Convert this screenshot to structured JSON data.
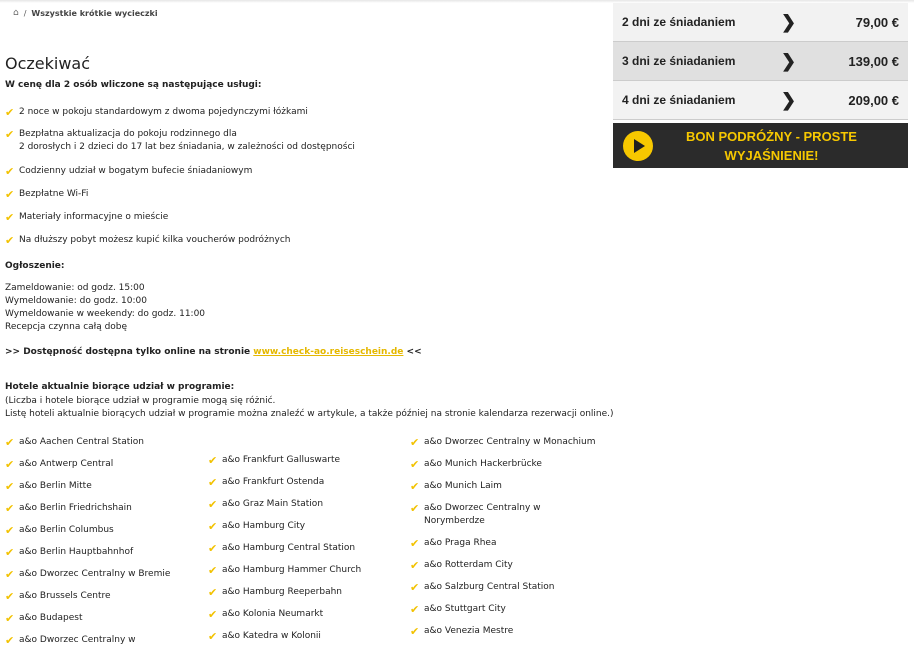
{
  "breadcrumb": {
    "home_icon": "home-icon",
    "separator": "/",
    "current": "Wszystkie krótkie wycieczki"
  },
  "title": "Oczekiwać",
  "included_heading": "W cenę dla 2 osób wliczone są następujące usługi:",
  "features": [
    {
      "line1": "2 noce w pokoju standardowym z dwoma pojedynczymi łóżkami",
      "line2": ""
    },
    {
      "line1": "Bezpłatna aktualizacja do pokoju rodzinnego dla",
      "line2": "2 dorosłych i 2 dzieci do 17 lat bez śniadania, w zależności od dostępności"
    },
    {
      "line1": "Codzienny udział w bogatym bufecie śniadaniowym",
      "line2": ""
    },
    {
      "line1": "Bezpłatne Wi-Fi",
      "line2": ""
    },
    {
      "line1": "Materiały informacyjne o mieście",
      "line2": ""
    },
    {
      "line1": "Na dłuższy pobyt możesz kupić kilka voucherów podróżnych",
      "line2": ""
    }
  ],
  "notice": {
    "heading": "Ogłoszenie:",
    "lines": [
      "Zameldowanie: od godz. 15:00",
      "Wymeldowanie: do godz. 10:00",
      "Wymeldowanie w weekendy: do godz. 11:00",
      "Recepcja czynna całą dobę"
    ]
  },
  "availability": {
    "prefix": ">> Dostępność dostępna tylko online na stronie ",
    "link": "www.check-ao.reiseschein.de",
    "suffix": " <<"
  },
  "hotels": {
    "heading": "Hotele aktualnie biorące udział w programie:",
    "note1": "(Liczba i hotele biorące udział w programie mogą się różnić.",
    "note2": "Listę hoteli aktualnie biorących udział w programie można znaleźć w artykule, a także później na stronie kalendarza rezerwacji online.)",
    "col1": [
      {
        "line1": "a&o Aachen Central Station",
        "line2": ""
      },
      {
        "line1": "a&o Antwerp Central",
        "line2": ""
      },
      {
        "line1": "a&o Berlin Mitte",
        "line2": ""
      },
      {
        "line1": "a&o Berlin Friedrichshain",
        "line2": ""
      },
      {
        "line1": "a&o Berlin Columbus",
        "line2": ""
      },
      {
        "line1": "a&o Berlin Hauptbahnhof",
        "line2": ""
      },
      {
        "line1": "a&o Dworzec Centralny w Bremie",
        "line2": ""
      },
      {
        "line1": "a&o Brussels Centre",
        "line2": ""
      },
      {
        "line1": "a&o Budapest",
        "line2": ""
      },
      {
        "line1": "a&o Dworzec Centralny w",
        "line2": ""
      }
    ],
    "col2": [
      {
        "line1": "a&o Frankfurt Galluswarte",
        "line2": ""
      },
      {
        "line1": "a&o Frankfurt Ostenda",
        "line2": ""
      },
      {
        "line1": "a&o Graz Main Station",
        "line2": ""
      },
      {
        "line1": "a&o Hamburg City",
        "line2": ""
      },
      {
        "line1": "a&o Hamburg Central Station",
        "line2": ""
      },
      {
        "line1": "a&o Hamburg Hammer Church",
        "line2": ""
      },
      {
        "line1": "a&o Hamburg Reeperbahn",
        "line2": ""
      },
      {
        "line1": "a&o Kolonia Neumarkt",
        "line2": ""
      },
      {
        "line1": "a&o Katedra w Kolonii",
        "line2": ""
      }
    ],
    "col3": [
      {
        "line1": "a&o Dworzec Centralny w Monachium",
        "line2": ""
      },
      {
        "line1": "a&o Munich Hackerbrücke",
        "line2": ""
      },
      {
        "line1": "a&o Munich Laim",
        "line2": ""
      },
      {
        "line1": "a&o Dworzec Centralny w",
        "line2": "Norymberdze"
      },
      {
        "line1": "a&o Praga Rhea",
        "line2": ""
      },
      {
        "line1": "a&o Rotterdam City",
        "line2": ""
      },
      {
        "line1": "a&o Salzburg Central Station",
        "line2": ""
      },
      {
        "line1": "a&o Stuttgart City",
        "line2": ""
      },
      {
        "line1": "a&o Venezia Mestre",
        "line2": ""
      }
    ]
  },
  "offers": [
    {
      "label": "2 dni ze śniadaniem",
      "price": "79,00 €"
    },
    {
      "label": "3 dni ze śniadaniem",
      "price": "139,00 €"
    },
    {
      "label": "4 dni ze śniadaniem",
      "price": "209,00 €"
    }
  ],
  "bon": {
    "line1": "BON PODRÓŻNY - PROSTE",
    "line2": "WYJAŚNIENIE!",
    "icon": "play-icon",
    "accent": "#f7c800",
    "background": "#2b2b2b"
  },
  "check_color": "#f2c200"
}
